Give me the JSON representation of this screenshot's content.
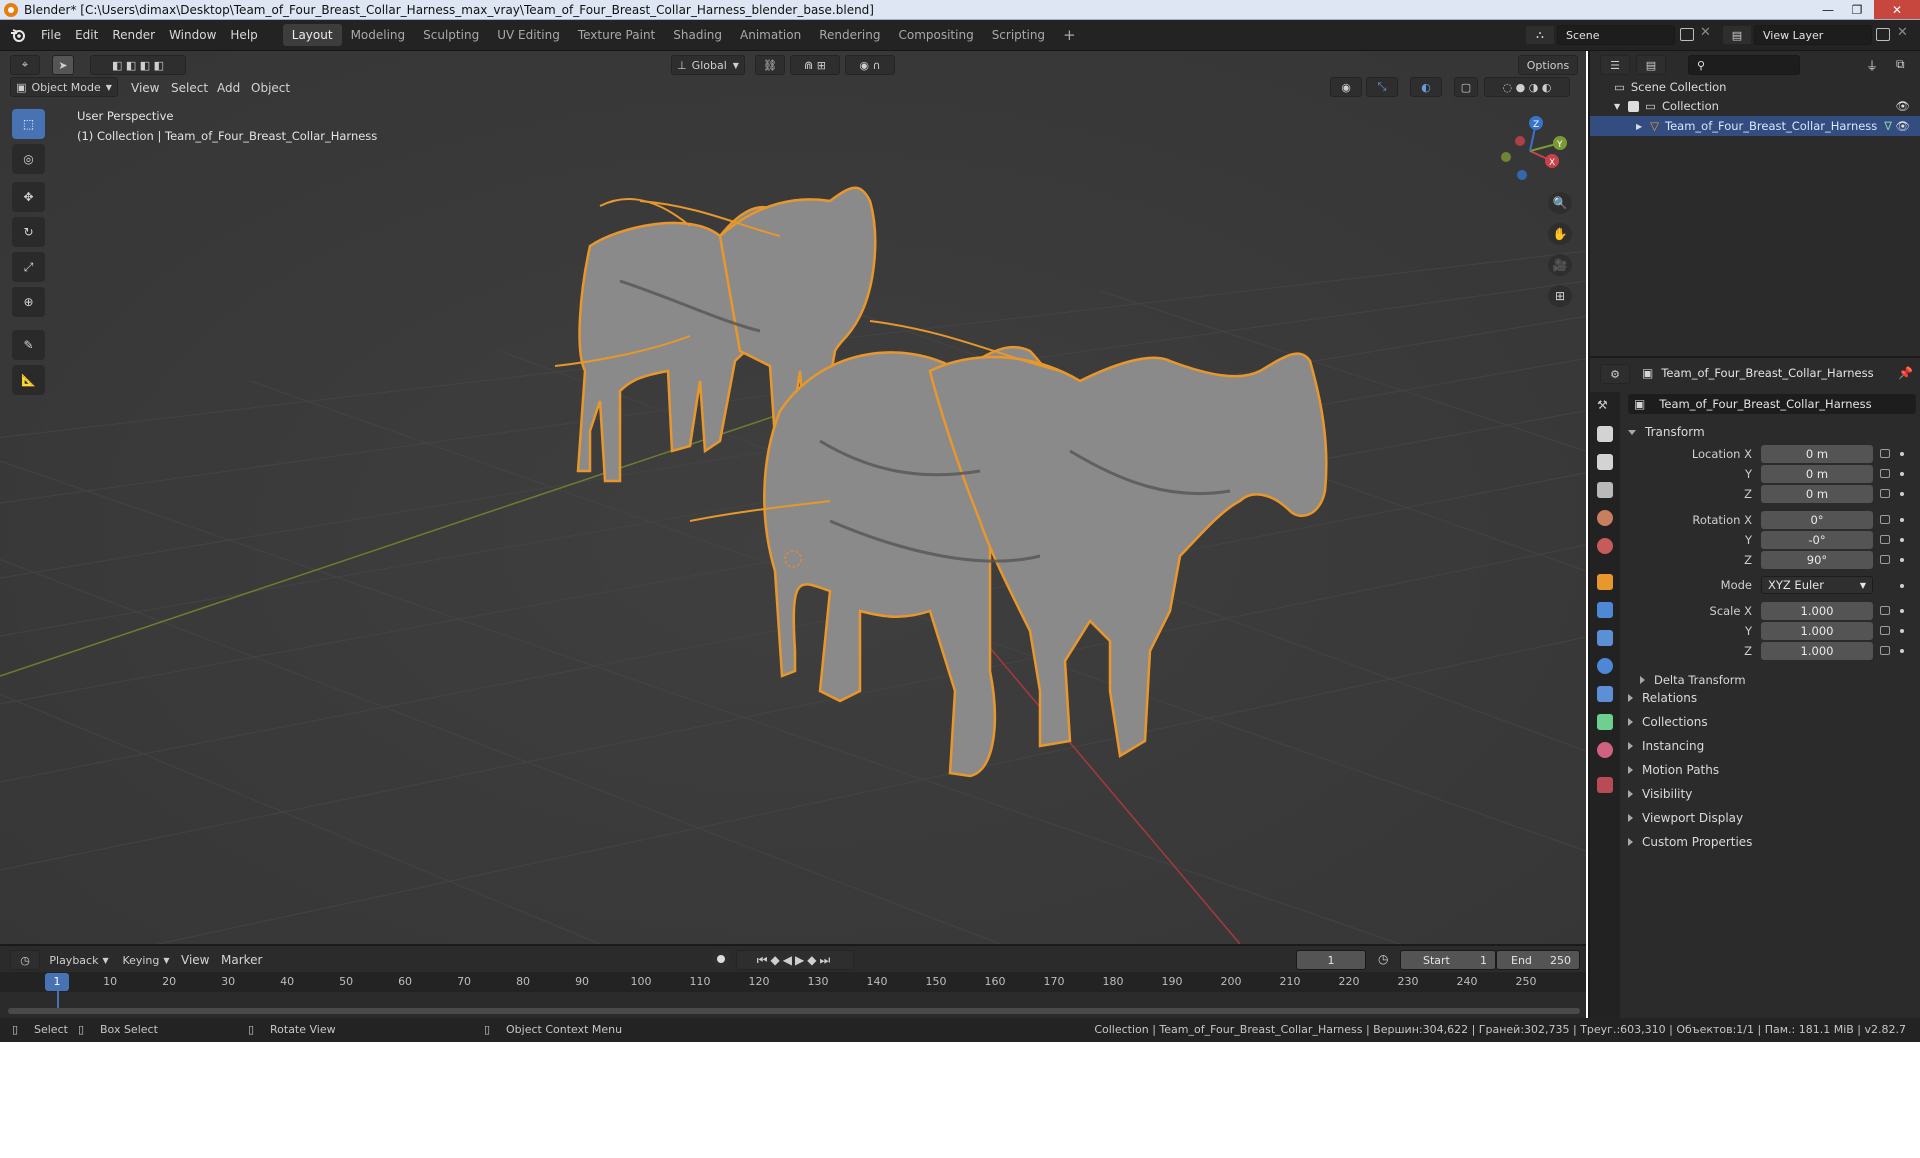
{
  "window": {
    "title": "Blender* [C:\\Users\\dimax\\Desktop\\Team_of_Four_Breast_Collar_Harness_max_vray\\Team_of_Four_Breast_Collar_Harness_blender_base.blend]",
    "minimize": "—",
    "maximize": "❐",
    "close": "✕"
  },
  "menu": [
    "File",
    "Edit",
    "Render",
    "Window",
    "Help"
  ],
  "workspaces": [
    "Layout",
    "Modeling",
    "Sculpting",
    "UV Editing",
    "Texture Paint",
    "Shading",
    "Animation",
    "Rendering",
    "Compositing",
    "Scripting"
  ],
  "workspace_add": "+",
  "scene": {
    "name": "Scene",
    "view_layer": "View Layer"
  },
  "viewport": {
    "transform_orientation": "Global",
    "options": "Options",
    "mode": "Object Mode",
    "header_menus": [
      "View",
      "Select",
      "Add",
      "Object"
    ],
    "info_line1": "User Perspective",
    "info_line2": "(1) Collection | Team_of_Four_Breast_Collar_Harness",
    "gizmo": {
      "x": "X",
      "y": "Y",
      "z": "Z"
    }
  },
  "outliner": {
    "scene_collection": "Scene Collection",
    "collection": "Collection",
    "object": "Team_of_Four_Breast_Collar_Harness"
  },
  "properties": {
    "object_name_header": "Team_of_Four_Breast_Collar_Harness",
    "object_name_field": "Team_of_Four_Breast_Collar_Harness",
    "transform_title": "Transform",
    "location_label": "Location X",
    "rotation_label": "Rotation X",
    "scale_label": "Scale X",
    "y_label": "Y",
    "z_label": "Z",
    "location": [
      "0 m",
      "0 m",
      "0 m"
    ],
    "rotation": [
      "0°",
      "-0°",
      "90°"
    ],
    "mode_label": "Mode",
    "mode_value": "XYZ Euler",
    "scale": [
      "1.000",
      "1.000",
      "1.000"
    ],
    "delta_transform": "Delta Transform",
    "panels": [
      "Relations",
      "Collections",
      "Instancing",
      "Motion Paths",
      "Visibility",
      "Viewport Display",
      "Custom Properties"
    ]
  },
  "timeline": {
    "menus": [
      "Playback",
      "Keying",
      "View",
      "Marker"
    ],
    "current_frame": "1",
    "start_label": "Start",
    "start": "1",
    "end_label": "End",
    "end": "250",
    "ruler": [
      "1",
      "10",
      "20",
      "30",
      "40",
      "50",
      "60",
      "70",
      "80",
      "90",
      "100",
      "110",
      "120",
      "130",
      "140",
      "150",
      "160",
      "170",
      "180",
      "190",
      "200",
      "210",
      "220",
      "230",
      "240",
      "250"
    ]
  },
  "status": {
    "select": "Select",
    "box_select": "Box Select",
    "rotate_view": "Rotate View",
    "context_menu": "Object Context Menu",
    "stats": "Collection | Team_of_Four_Breast_Collar_Harness | Вершин:304,622 | Граней:302,735 | Треуг.:603,310 | Объектов:1/1 | Пам.: 181.1 MiB | v2.82.7"
  },
  "colors": {
    "selection_outline": "#e8972c",
    "active_blue": "#4772b3",
    "axis_x": "#c9424b",
    "axis_y": "#7b9a34",
    "axis_z": "#3673c9"
  }
}
